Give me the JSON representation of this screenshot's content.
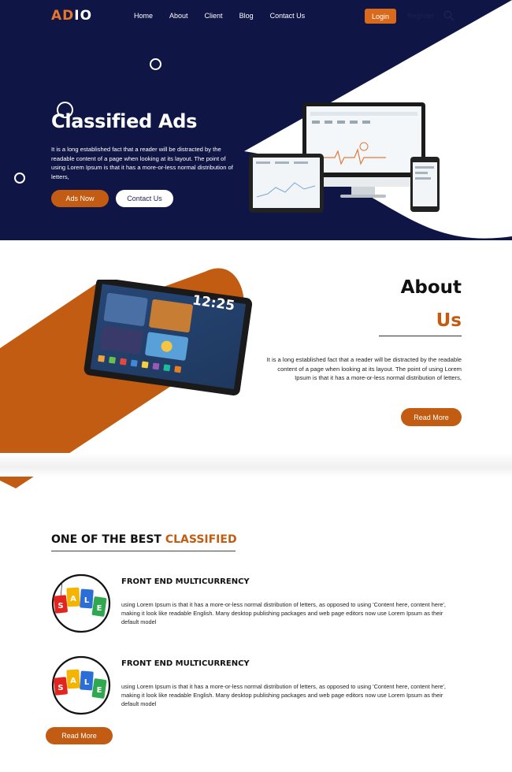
{
  "brand": {
    "logo_part1": "AD",
    "logo_part2": "IO"
  },
  "nav": {
    "links": [
      "Home",
      "About",
      "Client",
      "Blog",
      "Contact Us"
    ],
    "login": "Login",
    "register": "Register"
  },
  "hero": {
    "title": "Classified Ads",
    "text": "It is a long established fact that a reader will be distracted by the readable content of a page when looking at its layout. The point of using Lorem Ipsum is that it has a more-or-less normal distribution of letters,",
    "primary_button": "Ads Now",
    "secondary_button": "Contact Us"
  },
  "about": {
    "title_line1": "About",
    "title_line2": "Us",
    "text": "It is a long established fact that a reader will be distracted by the readable content of a page when looking at its layout. The point of using Lorem Ipsum is that it has a more-or-less normal distribution of letters,",
    "button": "Read More",
    "tablet_clock": "12:25"
  },
  "features": {
    "title_part1": "ONE OF THE BEST",
    "title_part2": "CLASSIFIED",
    "items": [
      {
        "title": "FRONT END MULTICURRENCY",
        "text": "using Lorem Ipsum is that it has a more-or-less normal distribution of letters, as opposed to using 'Content here, content here', making it look like readable English. Many desktop publishing packages and web page editors now use Lorem Ipsum as their default model"
      },
      {
        "title": "FRONT END MULTICURRENCY",
        "text": "using Lorem Ipsum is that it has a more-or-less normal distribution of letters, as opposed to using 'Content here, content here', making it look like readable English. Many desktop publishing packages and web page editors now use Lorem Ipsum as their default model"
      }
    ],
    "sale_letters": [
      "S",
      "A",
      "L",
      "E"
    ],
    "button": "Read More"
  },
  "colors": {
    "navy": "#0f1646",
    "orange": "#c15c12",
    "login_orange": "#d96a1b"
  }
}
